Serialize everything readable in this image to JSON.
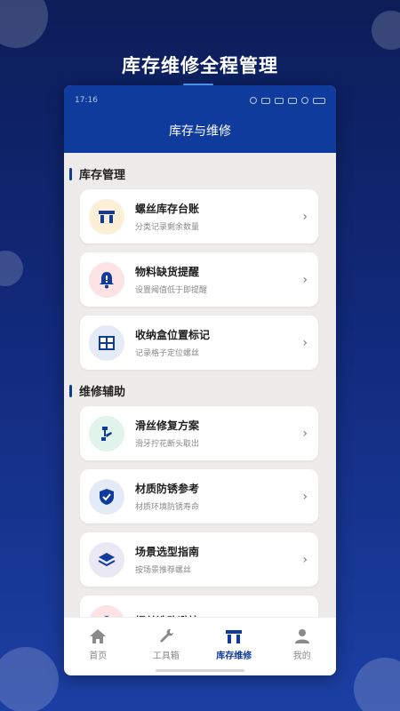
{
  "promo": {
    "title": "库存维修全程管理"
  },
  "status_bar": {
    "time": "17:16"
  },
  "header": {
    "title": "库存与维修"
  },
  "sections": [
    {
      "title": "库存管理",
      "items": [
        {
          "title": "螺丝库存台账",
          "subtitle": "分类记录剩余数量",
          "icon": "bracket-icon",
          "icon_bg": "#fcefd6",
          "icon_color": "#0f3b9d"
        },
        {
          "title": "物料缺货提醒",
          "subtitle": "设置阈值低于即提醒",
          "icon": "bell-icon",
          "icon_bg": "#fde3e3",
          "icon_color": "#0f3b9d"
        },
        {
          "title": "收纳盒位置标记",
          "subtitle": "记录格子定位螺丝",
          "icon": "grid-icon",
          "icon_bg": "#e4ebf7",
          "icon_color": "#0f3b9d"
        }
      ]
    },
    {
      "title": "维修辅助",
      "items": [
        {
          "title": "滑丝修复方案",
          "subtitle": "滑牙拧花断头取出",
          "icon": "repair-icon",
          "icon_bg": "#e2f3ec",
          "icon_color": "#0f3b9d"
        },
        {
          "title": "材质防锈参考",
          "subtitle": "材质环境防锈寿命",
          "icon": "shield-check-icon",
          "icon_bg": "#e4ebf7",
          "icon_color": "#0f3b9d"
        },
        {
          "title": "场景选型指南",
          "subtitle": "按场景推荐螺丝",
          "icon": "layers-icon",
          "icon_bg": "#ebe8f5",
          "icon_color": "#0f3b9d"
        },
        {
          "title": "螺丝选购避坑",
          "subtitle": "",
          "icon": "bag-icon",
          "icon_bg": "#fde3e3",
          "icon_color": "#0f3b9d"
        }
      ]
    }
  ],
  "tabs": [
    {
      "label": "首页",
      "icon": "home-icon"
    },
    {
      "label": "工具箱",
      "icon": "wrench-icon"
    },
    {
      "label": "库存维修",
      "icon": "bracket-icon",
      "active": true
    },
    {
      "label": "我的",
      "icon": "person-icon"
    }
  ],
  "colors": {
    "primary": "#0f3b9d",
    "page_bg": "#eeecea",
    "accent_line": "#4fa3ff"
  }
}
